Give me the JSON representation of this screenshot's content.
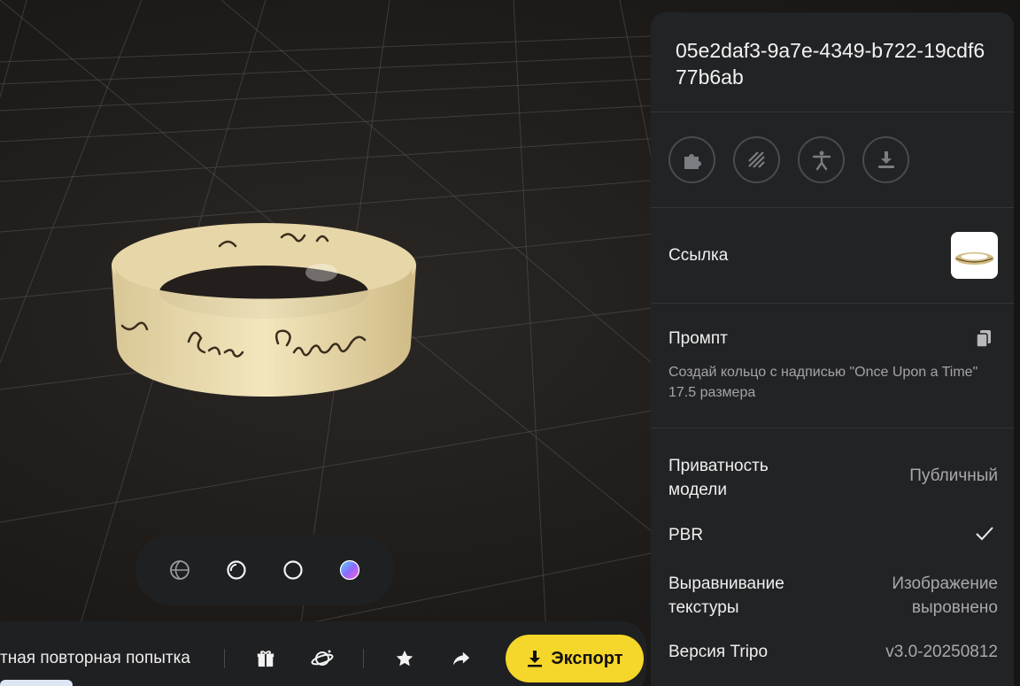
{
  "viewer": {
    "view_modes": [
      {
        "icon": "wireframe-globe-icon"
      },
      {
        "icon": "shaded-sphere-icon"
      },
      {
        "icon": "outline-circle-icon"
      },
      {
        "icon": "color-gradient-sphere-icon"
      }
    ]
  },
  "action_bar": {
    "retry_label": "тная повторная попытка",
    "icons": [
      "gift-icon",
      "planet-icon",
      "star-icon",
      "share-icon"
    ],
    "export_label": "Экспорт",
    "export_icon": "download-icon",
    "export_color": "#f5d62a"
  },
  "panel": {
    "model_id": "05e2daf3-9a7e-4349-b722-19cdf677b6ab",
    "tools": [
      "puzzle-icon",
      "texture-stripes-icon",
      "rig-figure-icon",
      "download-stack-icon"
    ],
    "reference_label": "Ссылка",
    "prompt_label": "Промпт",
    "prompt_text": "Создай кольцо с надписью \"Once Upon a Time\" 17.5 размера",
    "privacy_label": "Приватность модели",
    "privacy_value": "Публичный",
    "pbr_label": "PBR",
    "pbr_checked": true,
    "texture_label": "Выравнивание текстуры",
    "texture_value": "Изображение выровнено",
    "version_label": "Версия Tripo",
    "version_value": "v3.0-20250812"
  }
}
